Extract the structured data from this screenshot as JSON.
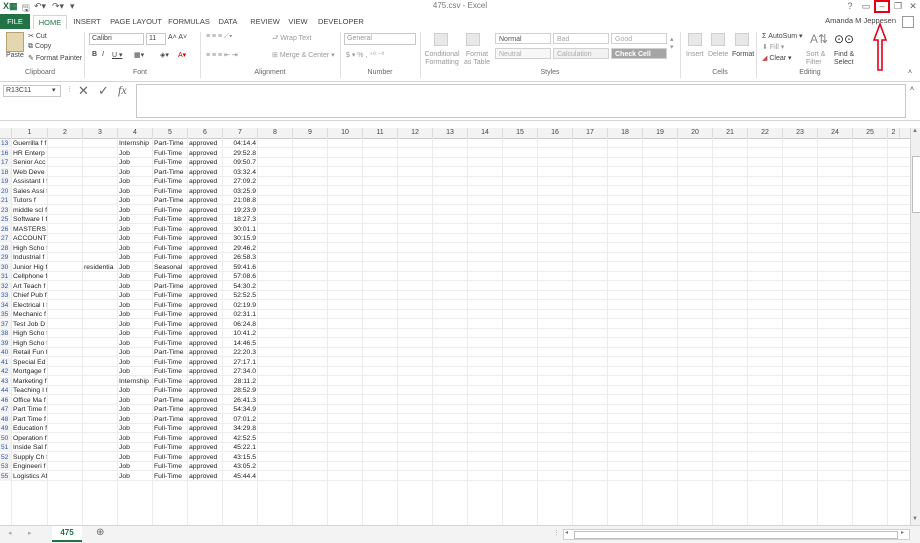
{
  "window": {
    "title": "475.csv - Excel",
    "user": "Amanda M Jeppesen"
  },
  "tabs": [
    "FILE",
    "HOME",
    "INSERT",
    "PAGE LAYOUT",
    "FORMULAS",
    "DATA",
    "REVIEW",
    "VIEW",
    "DEVELOPER"
  ],
  "ribbon": {
    "clipboard": {
      "paste": "Paste",
      "cut": "Cut",
      "copy": "Copy",
      "format_painter": "Format Painter",
      "group": "Clipboard"
    },
    "font": {
      "name": "Calibri",
      "size": "11",
      "group": "Font"
    },
    "alignment": {
      "wrap": "Wrap Text",
      "merge": "Merge & Center",
      "group": "Alignment"
    },
    "number": {
      "format": "General",
      "group": "Number"
    },
    "styles": {
      "conditional": "Conditional Formatting",
      "format_table": "Format as Table",
      "normal": "Normal",
      "bad": "Bad",
      "good": "Good",
      "neutral": "Neutral",
      "calculation": "Calculation",
      "check_cell": "Check Cell",
      "group": "Styles"
    },
    "cells": {
      "insert": "Insert",
      "delete": "Delete",
      "format": "Format",
      "group": "Cells"
    },
    "editing": {
      "autosum": "AutoSum",
      "fill": "Fill",
      "clear": "Clear",
      "sort": "Sort & Filter",
      "find": "Find & Select",
      "group": "Editing"
    }
  },
  "formula_bar": {
    "name_box": "R13C11",
    "fx": "fx",
    "value": ""
  },
  "columns": [
    "1",
    "2",
    "3",
    "4",
    "5",
    "6",
    "7",
    "8",
    "9",
    "10",
    "11",
    "12",
    "13",
    "14",
    "15",
    "16",
    "17",
    "18",
    "19",
    "20",
    "21",
    "22",
    "23",
    "24",
    "25",
    "2"
  ],
  "rows": [
    {
      "n": "13",
      "c1": "Guerrilla f f",
      "c3": "",
      "c4": "Internship",
      "c5": "Part-Time",
      "c6": "approved",
      "c7": "04:14.4"
    },
    {
      "n": "16",
      "c1": "HR Enterp f",
      "c3": "",
      "c4": "Job",
      "c5": "Full-Time",
      "c6": "approved",
      "c7": "29:52.8"
    },
    {
      "n": "17",
      "c1": "Senior Acc f",
      "c3": "",
      "c4": "Job",
      "c5": "Full-Time",
      "c6": "approved",
      "c7": "09:50.7"
    },
    {
      "n": "18",
      "c1": "Web Deve f",
      "c3": "",
      "c4": "Job",
      "c5": "Part-Time",
      "c6": "approved",
      "c7": "03:32.4"
    },
    {
      "n": "19",
      "c1": "Assistant I f",
      "c3": "",
      "c4": "Job",
      "c5": "Full-Time",
      "c6": "approved",
      "c7": "27:09.2"
    },
    {
      "n": "20",
      "c1": "Sales Assi f",
      "c3": "",
      "c4": "Job",
      "c5": "Full-Time",
      "c6": "approved",
      "c7": "03:25.9"
    },
    {
      "n": "21",
      "c1": "Tutors     f",
      "c3": "",
      "c4": "Job",
      "c5": "Part-Time",
      "c6": "approved",
      "c7": "21:08.8"
    },
    {
      "n": "23",
      "c1": "middle scl f",
      "c3": "",
      "c4": "Job",
      "c5": "Full-Time",
      "c6": "approved",
      "c7": "19:23.9"
    },
    {
      "n": "25",
      "c1": "Software I f",
      "c3": "",
      "c4": "Job",
      "c5": "Full-Time",
      "c6": "approved",
      "c7": "18:27.3"
    },
    {
      "n": "26",
      "c1": "MASTERS  f",
      "c3": "",
      "c4": "Job",
      "c5": "Full-Time",
      "c6": "approved",
      "c7": "30:01.1"
    },
    {
      "n": "27",
      "c1": "ACCOUNT f",
      "c3": "",
      "c4": "Job",
      "c5": "Full-Time",
      "c6": "approved",
      "c7": "30:15.9"
    },
    {
      "n": "28",
      "c1": "High Scho f",
      "c3": "",
      "c4": "Job",
      "c5": "Full-Time",
      "c6": "approved",
      "c7": "29:46.2"
    },
    {
      "n": "29",
      "c1": "Industrial f",
      "c3": "",
      "c4": "Job",
      "c5": "Full-Time",
      "c6": "approved",
      "c7": "26:58.3"
    },
    {
      "n": "30",
      "c1": "Junior Hig f",
      "c3": "residentia",
      "c4": "Job",
      "c5": "Seasonal",
      "c6": "approved",
      "c7": "59:41.6"
    },
    {
      "n": "31",
      "c1": "Cellphone f",
      "c3": "",
      "c4": "Job",
      "c5": "Full-Time",
      "c6": "approved",
      "c7": "57:08.6"
    },
    {
      "n": "32",
      "c1": "Art Teach f",
      "c3": "",
      "c4": "Job",
      "c5": "Part-Time",
      "c6": "approved",
      "c7": "54:30.2"
    },
    {
      "n": "33",
      "c1": "Chief Pub f",
      "c3": "",
      "c4": "Job",
      "c5": "Full-Time",
      "c6": "approved",
      "c7": "52:52.5"
    },
    {
      "n": "34",
      "c1": "Electrical I f",
      "c3": "",
      "c4": "Job",
      "c5": "Full-Time",
      "c6": "approved",
      "c7": "02:19.9"
    },
    {
      "n": "35",
      "c1": "Mechanic f",
      "c3": "",
      "c4": "Job",
      "c5": "Full-Time",
      "c6": "approved",
      "c7": "02:31.1"
    },
    {
      "n": "37",
      "c1": "Test Job D f",
      "c3": "",
      "c4": "Job",
      "c5": "Full-Time",
      "c6": "approved",
      "c7": "06:24.8"
    },
    {
      "n": "38",
      "c1": "High Scho f",
      "c3": "",
      "c4": "Job",
      "c5": "Full-Time",
      "c6": "approved",
      "c7": "10:41.2"
    },
    {
      "n": "39",
      "c1": "High Scho f",
      "c3": "",
      "c4": "Job",
      "c5": "Full-Time",
      "c6": "approved",
      "c7": "14:46.5"
    },
    {
      "n": "40",
      "c1": "Retail Fun f",
      "c3": "",
      "c4": "Job",
      "c5": "Part-Time",
      "c6": "approved",
      "c7": "22:20.3"
    },
    {
      "n": "41",
      "c1": "Special Ed f",
      "c3": "",
      "c4": "Job",
      "c5": "Full-Time",
      "c6": "approved",
      "c7": "27:17.1"
    },
    {
      "n": "42",
      "c1": "Mortgage f",
      "c3": "",
      "c4": "Job",
      "c5": "Full-Time",
      "c6": "approved",
      "c7": "27:34.0"
    },
    {
      "n": "43",
      "c1": "Marketing f",
      "c3": "",
      "c4": "Internship",
      "c5": "Full-Time",
      "c6": "approved",
      "c7": "28:11.2"
    },
    {
      "n": "44",
      "c1": "Teaching I f",
      "c3": "",
      "c4": "Job",
      "c5": "Full-Time",
      "c6": "approved",
      "c7": "28:52.9"
    },
    {
      "n": "46",
      "c1": "Office Ma f",
      "c3": "",
      "c4": "Job",
      "c5": "Part-Time",
      "c6": "approved",
      "c7": "26:41.3"
    },
    {
      "n": "47",
      "c1": "Part Time f",
      "c3": "",
      "c4": "Job",
      "c5": "Part-Time",
      "c6": "approved",
      "c7": "54:34.9"
    },
    {
      "n": "48",
      "c1": "Part Time f",
      "c3": "",
      "c4": "Job",
      "c5": "Part-Time",
      "c6": "approved",
      "c7": "07:01.2"
    },
    {
      "n": "49",
      "c1": "Education f",
      "c3": "",
      "c4": "Job",
      "c5": "Full-Time",
      "c6": "approved",
      "c7": "34:29.8"
    },
    {
      "n": "50",
      "c1": "Operation f",
      "c3": "",
      "c4": "Job",
      "c5": "Full-Time",
      "c6": "approved",
      "c7": "42:52.5"
    },
    {
      "n": "51",
      "c1": "Inside Sal f",
      "c3": "",
      "c4": "Job",
      "c5": "Full-Time",
      "c6": "approved",
      "c7": "45:22.1"
    },
    {
      "n": "52",
      "c1": "Supply Ch f",
      "c3": "",
      "c4": "Job",
      "c5": "Full-Time",
      "c6": "approved",
      "c7": "43:15.5"
    },
    {
      "n": "53",
      "c1": "Engineeri f",
      "c3": "",
      "c4": "Job",
      "c5": "Full-Time",
      "c6": "approved",
      "c7": "43:05.2"
    },
    {
      "n": "55",
      "c1": "Logistics Af",
      "c3": "",
      "c4": "Job",
      "c5": "Full-Time",
      "c6": "approved",
      "c7": "45:44.4"
    }
  ],
  "sheet_tab": "475",
  "colors": {
    "accent": "#217346",
    "highlight": "#e3001b",
    "row_number": "#2a59a8"
  }
}
